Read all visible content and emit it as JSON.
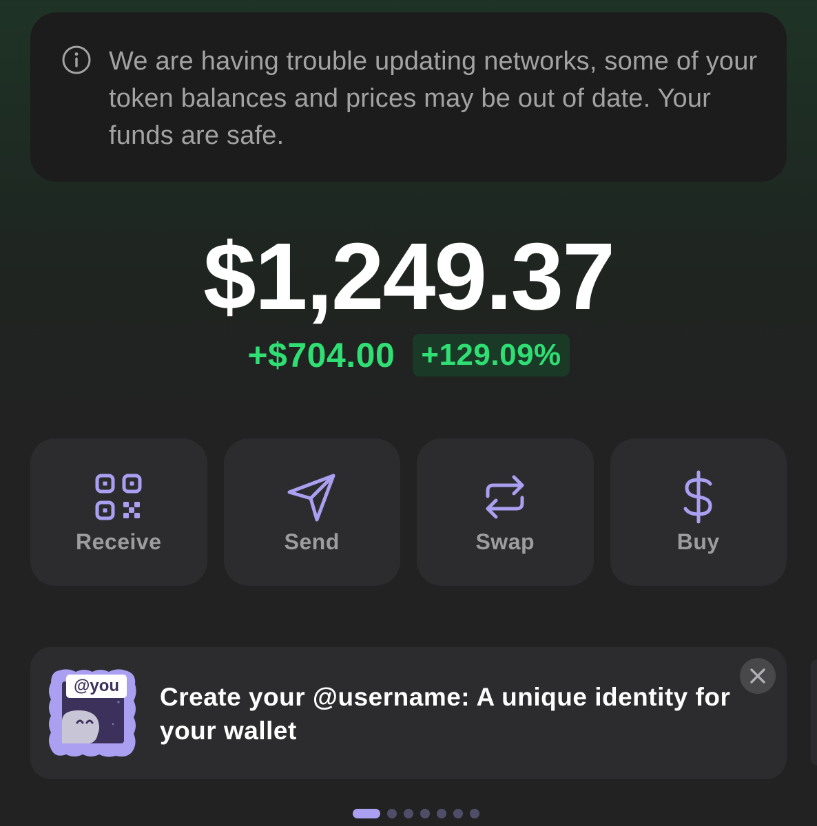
{
  "banner": {
    "icon": "info-icon",
    "message": "We are having trouble updating networks, some of your token balances and prices may be out of date. Your funds are safe."
  },
  "portfolio": {
    "balance": "$1,249.37",
    "change_amount": "+$704.00",
    "change_percent": "+129.09%",
    "positive_color": "#2fdf74"
  },
  "actions": [
    {
      "label": "Receive",
      "icon": "qr-code-icon"
    },
    {
      "label": "Send",
      "icon": "send-icon"
    },
    {
      "label": "Swap",
      "icon": "swap-icon"
    },
    {
      "label": "Buy",
      "icon": "dollar-icon"
    }
  ],
  "promo": {
    "badge": "@you",
    "text": "Create your @username: A unique identity for your wallet",
    "close_icon": "close-icon"
  },
  "pager": {
    "total": 7,
    "active_index": 0
  },
  "colors": {
    "accent": "#ab9ff2",
    "card": "#2c2c2f",
    "banner": "#1c1c1c"
  }
}
